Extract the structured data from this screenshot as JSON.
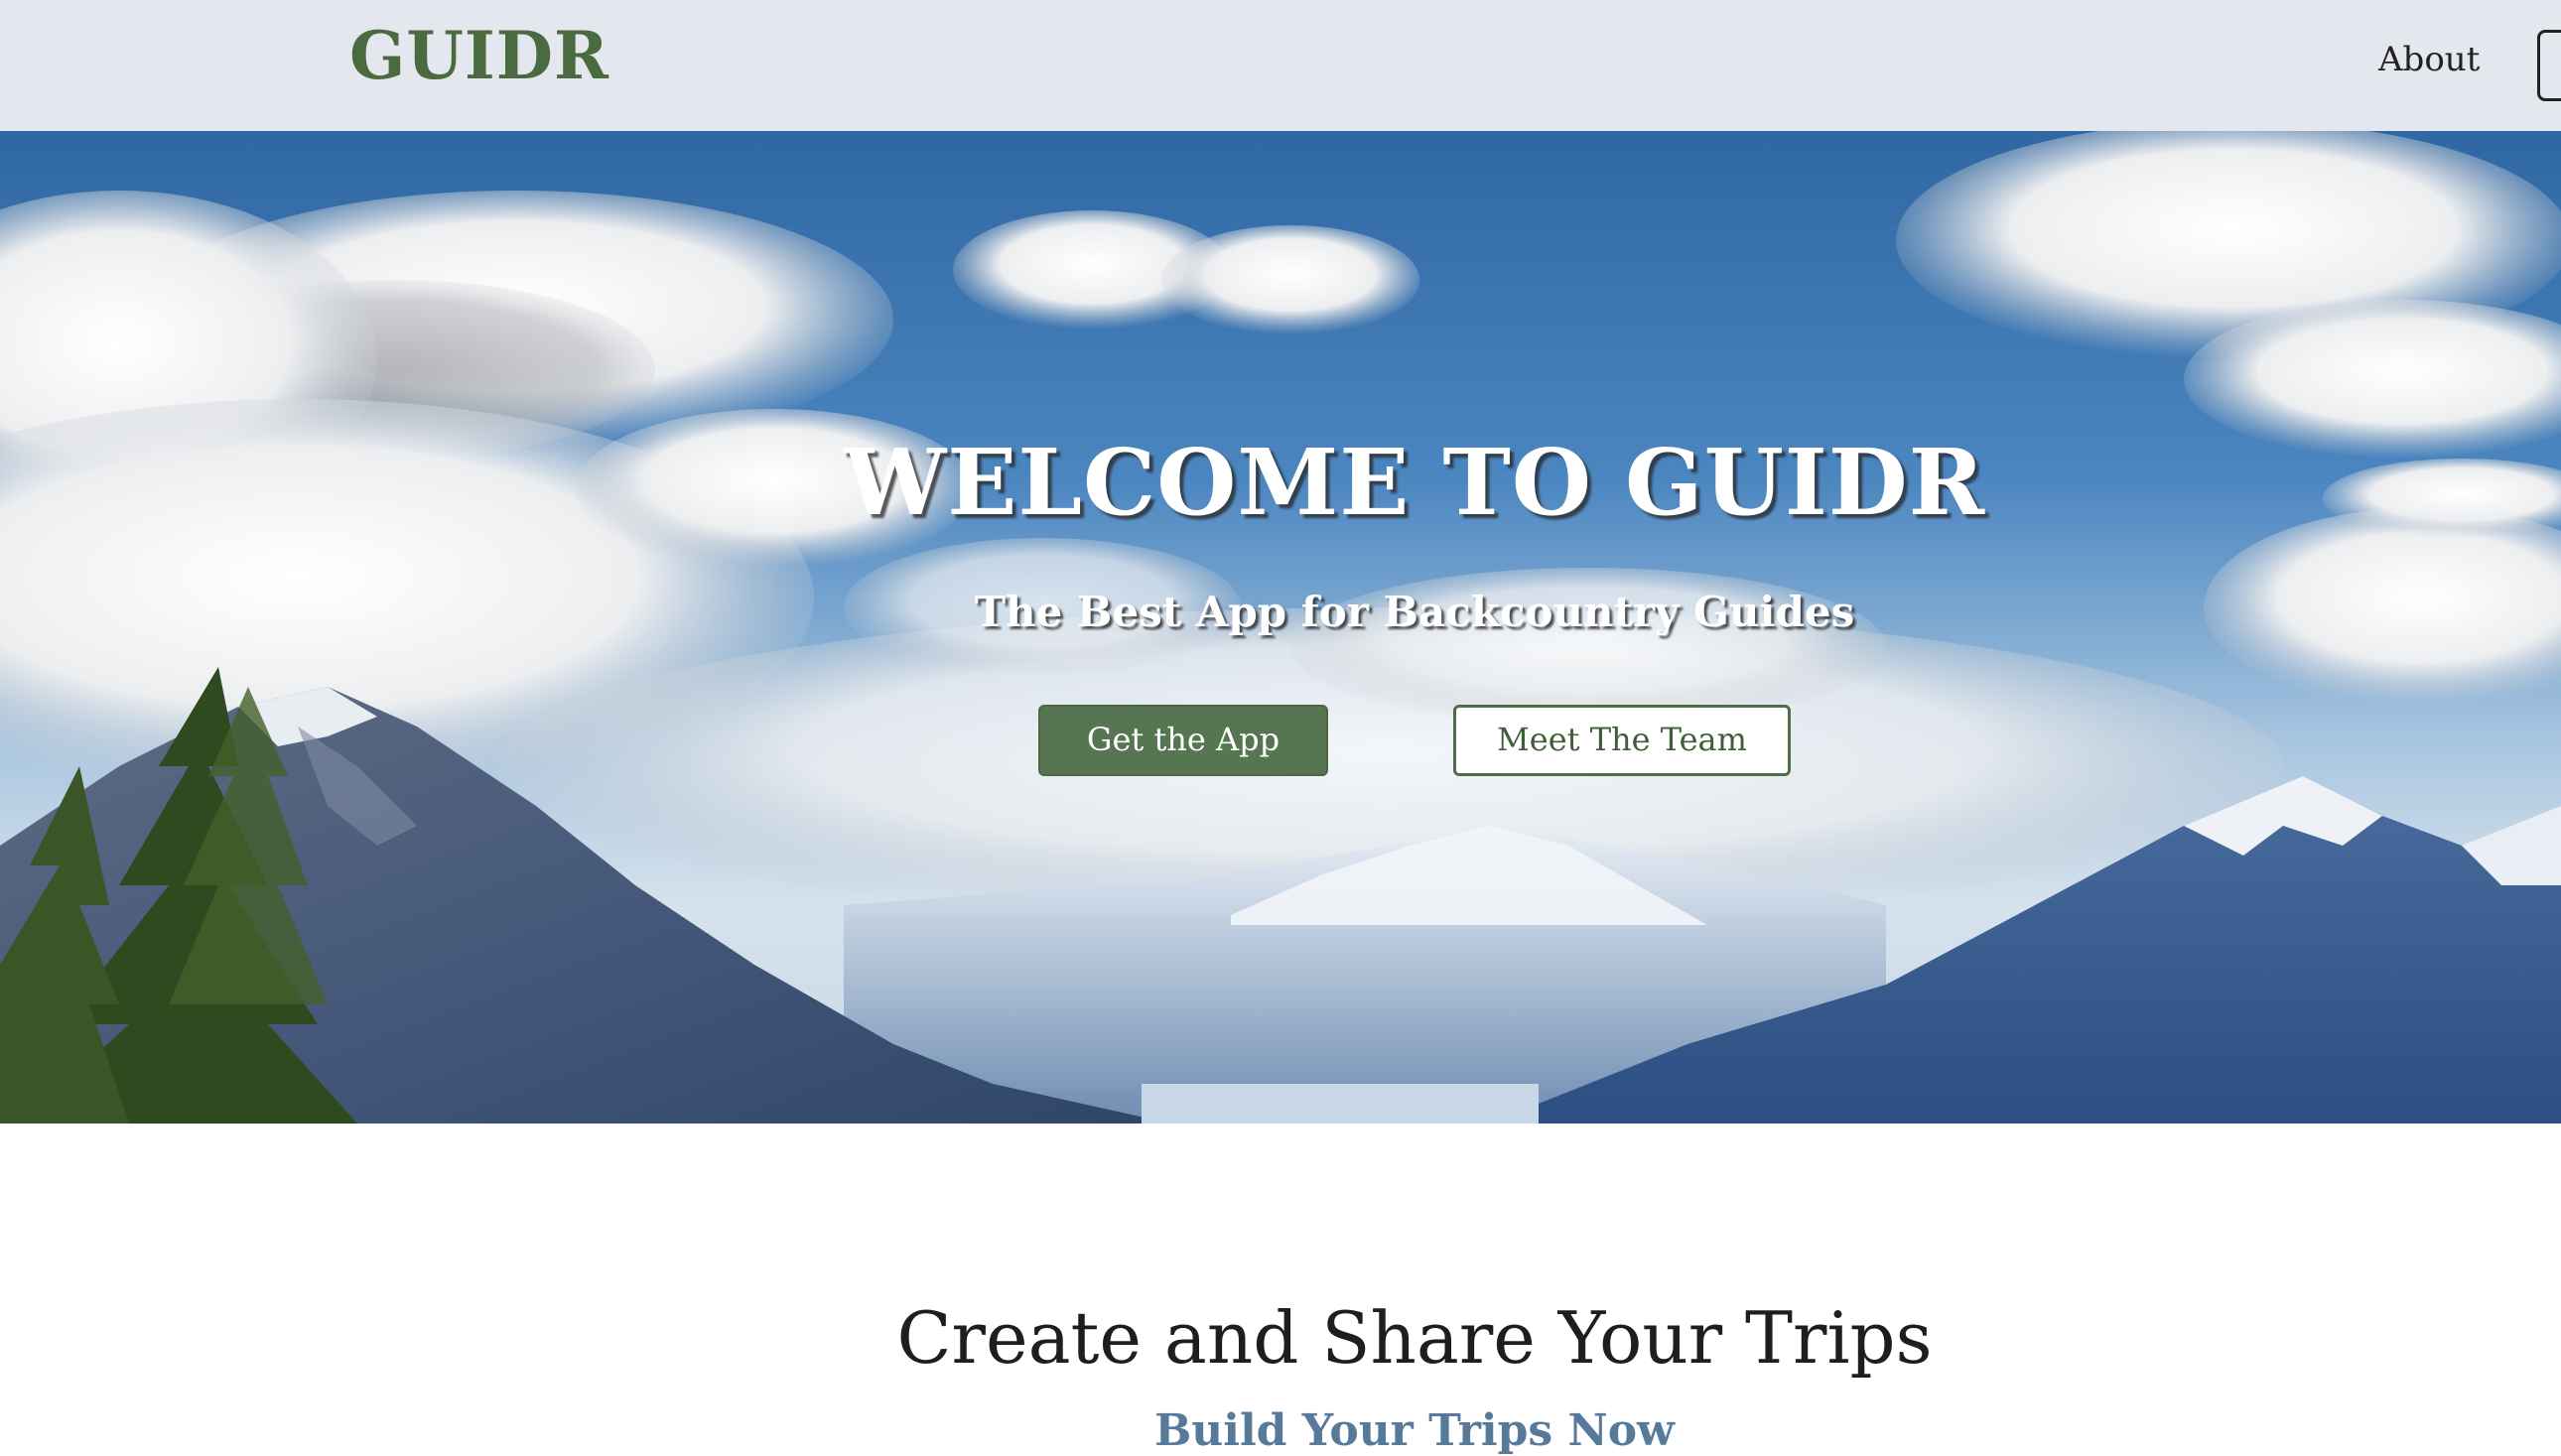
{
  "header": {
    "logo": "GUIDR",
    "nav": {
      "about": "About"
    }
  },
  "hero": {
    "title": "WELCOME TO GUIDR",
    "subtitle": "The Best App for Backcountry Guides",
    "primary_button": "Get the App",
    "secondary_button": "Meet The Team"
  },
  "section": {
    "title": "Create and Share Your Trips",
    "subtitle": "Build Your Trips Now"
  },
  "colors": {
    "brand_green": "#4a6a3f",
    "header_bg": "#e4e7ee",
    "button_green": "#567651",
    "subtitle_blue": "#587a9a"
  }
}
